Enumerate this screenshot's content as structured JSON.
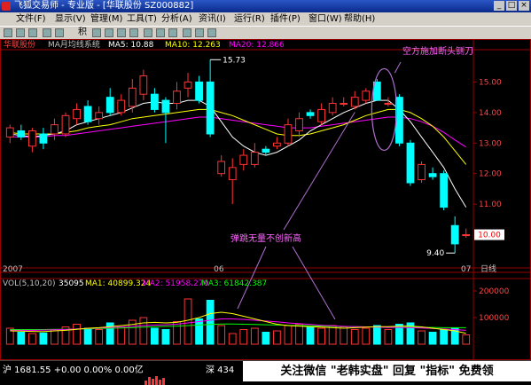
{
  "window": {
    "title": "飞狐交易师 - 专业版 - [华联股份 SZ000882]",
    "buttons": [
      "_",
      "□",
      "×"
    ]
  },
  "menu": [
    "文件(F)",
    "显示(V)",
    "管理(M)",
    "工具(T)",
    "分析(A)",
    "资讯(I)",
    "运行(R)",
    "插件(P)",
    "窗口(W)",
    "帮助(H)"
  ],
  "toolbar": {
    "period": "积"
  },
  "header": {
    "stock": "华联股份",
    "indicator": "MA月均线系统",
    "ma5": "MA5: 10.88",
    "ma10": "MA10: 12.263",
    "ma20": "MA20: 12.866"
  },
  "annotations": {
    "top": "空方施加断头铡刀",
    "mid": "弹跳无量不创新高",
    "high_label": "15.73",
    "low_label": "9.40",
    "price_box": "10.00"
  },
  "axis_labels": {
    "x_2007": "2007",
    "x_06": "06",
    "x_07": "07",
    "x_unit": "日线"
  },
  "volume_header": {
    "name": "VOL(5,10,20)",
    "vol": "35095",
    "ma1": "MA1: 40899.324",
    "ma2": "MA2: 51958.270",
    "ma3": "MA3: 61842.387"
  },
  "status": {
    "sh": "沪 1681.55 +0.00 0.00% 0.00亿",
    "sz": "深 434",
    "watermark": "关注微信 \"老韩实盘\" 回复 \"指标\" 免费领"
  },
  "colors": {
    "up": "#ff3333",
    "down": "#00ffff",
    "ma5": "#ffffff",
    "ma10": "#ffff00",
    "ma20": "#ff00ff",
    "grid": "#990000"
  },
  "chart_data": {
    "type": "candlestick",
    "y_ticks": [
      11.0,
      12.0,
      13.0,
      14.0,
      15.0
    ],
    "ylim": [
      9.0,
      16.0
    ],
    "volume_ticks": [
      "200000",
      "100000"
    ],
    "volume_ylim": [
      0,
      230000
    ],
    "candles": [
      {
        "o": 13.2,
        "c": 13.5,
        "h": 13.6,
        "l": 13.0
      },
      {
        "o": 13.4,
        "c": 13.2,
        "h": 13.6,
        "l": 13.1
      },
      {
        "o": 12.9,
        "c": 13.4,
        "h": 13.5,
        "l": 12.7
      },
      {
        "o": 13.3,
        "c": 13.0,
        "h": 13.5,
        "l": 12.8
      },
      {
        "o": 13.3,
        "c": 13.6,
        "h": 13.8,
        "l": 13.1
      },
      {
        "o": 13.3,
        "c": 13.9,
        "h": 14.0,
        "l": 13.2
      },
      {
        "o": 13.8,
        "c": 14.1,
        "h": 14.3,
        "l": 13.6
      },
      {
        "o": 14.2,
        "c": 13.7,
        "h": 14.4,
        "l": 13.6
      },
      {
        "o": 13.8,
        "c": 14.0,
        "h": 14.2,
        "l": 13.6
      },
      {
        "o": 14.5,
        "c": 14.0,
        "h": 14.8,
        "l": 13.9
      },
      {
        "o": 14.0,
        "c": 14.4,
        "h": 14.6,
        "l": 13.9
      },
      {
        "o": 14.2,
        "c": 14.8,
        "h": 15.1,
        "l": 14.0
      },
      {
        "o": 14.6,
        "c": 15.2,
        "h": 15.4,
        "l": 14.4
      },
      {
        "o": 14.6,
        "c": 14.1,
        "h": 14.8,
        "l": 14.0
      },
      {
        "o": 14.4,
        "c": 14.0,
        "h": 14.5,
        "l": 13.0
      },
      {
        "o": 14.3,
        "c": 14.7,
        "h": 15.0,
        "l": 14.1
      },
      {
        "o": 14.8,
        "c": 15.0,
        "h": 15.3,
        "l": 14.5
      },
      {
        "o": 15.0,
        "c": 14.4,
        "h": 15.2,
        "l": 14.3
      },
      {
        "o": 15.0,
        "c": 13.3,
        "h": 15.73,
        "l": 13.2
      },
      {
        "o": 12.0,
        "c": 12.4,
        "h": 12.6,
        "l": 11.9
      },
      {
        "o": 11.8,
        "c": 12.2,
        "h": 12.5,
        "l": 11.0
      },
      {
        "o": 12.3,
        "c": 12.6,
        "h": 12.8,
        "l": 12.1
      },
      {
        "o": 12.3,
        "c": 12.7,
        "h": 13.0,
        "l": 12.2
      },
      {
        "o": 12.8,
        "c": 12.7,
        "h": 12.9,
        "l": 12.6
      },
      {
        "o": 12.9,
        "c": 13.0,
        "h": 13.2,
        "l": 12.8
      },
      {
        "o": 13.0,
        "c": 13.6,
        "h": 13.8,
        "l": 12.9
      },
      {
        "o": 13.4,
        "c": 13.8,
        "h": 14.0,
        "l": 13.2
      },
      {
        "o": 14.0,
        "c": 13.9,
        "h": 14.1,
        "l": 13.8
      },
      {
        "o": 13.7,
        "c": 14.1,
        "h": 14.3,
        "l": 13.6
      },
      {
        "o": 14.0,
        "c": 14.3,
        "h": 14.5,
        "l": 13.9
      },
      {
        "o": 14.3,
        "c": 14.3,
        "h": 14.5,
        "l": 14.2
      },
      {
        "o": 14.2,
        "c": 14.5,
        "h": 14.7,
        "l": 14.1
      },
      {
        "o": 14.4,
        "c": 14.7,
        "h": 14.8,
        "l": 14.3
      },
      {
        "o": 15.0,
        "c": 14.4,
        "h": 15.1,
        "l": 14.4
      },
      {
        "o": 14.3,
        "c": 14.3,
        "h": 14.5,
        "l": 14.2
      },
      {
        "o": 14.5,
        "c": 13.0,
        "h": 14.6,
        "l": 12.9
      },
      {
        "o": 13.0,
        "c": 11.7,
        "h": 13.1,
        "l": 11.6
      },
      {
        "o": 11.8,
        "c": 12.3,
        "h": 12.4,
        "l": 11.7
      },
      {
        "o": 12.0,
        "c": 11.9,
        "h": 12.2,
        "l": 11.8
      },
      {
        "o": 12.0,
        "c": 10.9,
        "h": 12.1,
        "l": 10.8
      },
      {
        "o": 10.3,
        "c": 9.7,
        "h": 10.6,
        "l": 9.4
      },
      {
        "o": 10.0,
        "c": 10.0,
        "h": 10.2,
        "l": 9.9
      }
    ],
    "ma5": [
      13.3,
      13.25,
      13.2,
      13.25,
      13.3,
      13.4,
      13.6,
      13.7,
      13.8,
      13.9,
      14.0,
      14.15,
      14.3,
      14.35,
      14.3,
      14.3,
      14.4,
      14.4,
      14.2,
      13.7,
      13.2,
      12.9,
      12.7,
      12.6,
      12.7,
      12.9,
      13.1,
      13.4,
      13.6,
      13.8,
      14.0,
      14.15,
      14.3,
      14.4,
      14.4,
      14.1,
      13.7,
      13.2,
      12.7,
      12.2,
      11.5,
      10.9
    ],
    "ma10": [
      13.35,
      13.3,
      13.3,
      13.3,
      13.3,
      13.35,
      13.4,
      13.5,
      13.55,
      13.6,
      13.7,
      13.8,
      13.85,
      13.9,
      13.95,
      14.0,
      14.05,
      14.1,
      14.1,
      14.0,
      13.9,
      13.75,
      13.6,
      13.45,
      13.3,
      13.25,
      13.25,
      13.3,
      13.4,
      13.5,
      13.6,
      13.75,
      13.9,
      14.0,
      14.1,
      14.1,
      14.0,
      13.8,
      13.55,
      13.2,
      12.75,
      12.3
    ],
    "ma20": [
      13.2,
      13.2,
      13.2,
      13.2,
      13.25,
      13.25,
      13.3,
      13.35,
      13.4,
      13.45,
      13.5,
      13.55,
      13.6,
      13.65,
      13.7,
      13.75,
      13.8,
      13.85,
      13.85,
      13.8,
      13.75,
      13.7,
      13.65,
      13.6,
      13.55,
      13.5,
      13.5,
      13.5,
      13.55,
      13.6,
      13.65,
      13.7,
      13.75,
      13.8,
      13.85,
      13.85,
      13.8,
      13.7,
      13.55,
      13.35,
      13.1,
      12.87
    ],
    "volumes": [
      60000,
      45000,
      40000,
      42000,
      55000,
      65000,
      75000,
      60000,
      55000,
      80000,
      65000,
      90000,
      100000,
      60000,
      55000,
      85000,
      170000,
      95000,
      165000,
      70000,
      40000,
      55000,
      60000,
      45000,
      50000,
      70000,
      75000,
      65000,
      60000,
      70000,
      65000,
      55000,
      60000,
      70000,
      55000,
      75000,
      80000,
      50000,
      45000,
      55000,
      60000,
      35095
    ],
    "vol_ma1": [
      50000,
      49000,
      48000,
      47000,
      50000,
      52000,
      56000,
      60000,
      62000,
      66000,
      70000,
      74000,
      80000,
      82000,
      80000,
      82000,
      90000,
      100000,
      115000,
      120000,
      115000,
      105000,
      95000,
      85000,
      75000,
      70000,
      68000,
      66000,
      64000,
      62000,
      60000,
      62000,
      64000,
      66000,
      66000,
      68000,
      68000,
      65000,
      60000,
      55000,
      50000,
      40899
    ],
    "vol_ma2": [
      52000,
      52000,
      52000,
      53000,
      54000,
      55000,
      57000,
      59000,
      61000,
      63000,
      65000,
      67000,
      70000,
      72000,
      73000,
      75000,
      80000,
      85000,
      90000,
      95000,
      95000,
      93000,
      90000,
      87000,
      84000,
      80000,
      77000,
      74000,
      71000,
      69000,
      67000,
      66000,
      65000,
      64000,
      63000,
      63000,
      62000,
      61000,
      59000,
      57000,
      55000,
      51958
    ],
    "vol_ma3": [
      55000,
      55000,
      55000,
      55000,
      56000,
      56000,
      57000,
      58000,
      59000,
      60000,
      61000,
      62000,
      64000,
      66000,
      67000,
      68000,
      70000,
      72000,
      74000,
      76000,
      76000,
      75000,
      74000,
      73000,
      72000,
      71000,
      70000,
      69000,
      68000,
      67000,
      66000,
      66000,
      65000,
      65000,
      64000,
      64000,
      64000,
      63000,
      63000,
      62000,
      62000,
      61842
    ]
  }
}
